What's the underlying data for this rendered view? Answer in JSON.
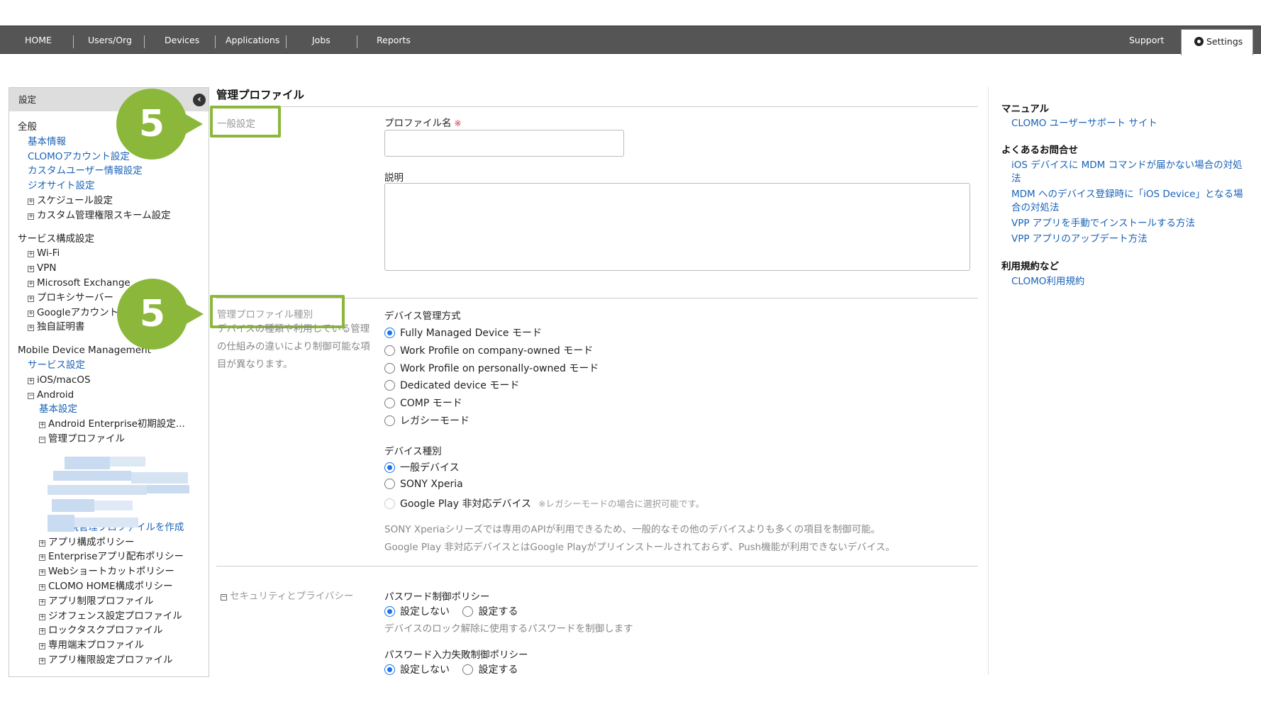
{
  "nav": {
    "items": [
      "HOME",
      "Users/Org",
      "Devices",
      "Applications",
      "Jobs",
      "Reports"
    ],
    "support": "Support",
    "settings": "Settings"
  },
  "sidebar": {
    "header": "設定",
    "tree": [
      {
        "text": "全般",
        "type": "heading"
      },
      {
        "text": "基本情報",
        "type": "link",
        "indent": 1
      },
      {
        "text": "CLOMOアカウント設定",
        "type": "link",
        "indent": 1
      },
      {
        "text": "カスタムユーザー情報設定",
        "type": "link",
        "indent": 1
      },
      {
        "text": "ジオサイト設定",
        "type": "link",
        "indent": 1
      },
      {
        "text": "スケジュール設定",
        "type": "expand",
        "indent": 1
      },
      {
        "text": "カスタム管理権限スキーム設定",
        "type": "expand",
        "indent": 1
      },
      {
        "text": "",
        "type": "gap"
      },
      {
        "text": "サービス構成設定",
        "type": "heading"
      },
      {
        "text": "Wi-Fi",
        "type": "expand",
        "indent": 1
      },
      {
        "text": "VPN",
        "type": "expand",
        "indent": 1
      },
      {
        "text": "Microsoft Exchange",
        "type": "expand",
        "indent": 1
      },
      {
        "text": "プロキシサーバー",
        "type": "expand",
        "indent": 1
      },
      {
        "text": "Googleアカウント",
        "type": "expand",
        "indent": 1
      },
      {
        "text": "独自証明書",
        "type": "expand",
        "indent": 1
      },
      {
        "text": "",
        "type": "gap"
      },
      {
        "text": "Mobile Device Management",
        "type": "heading"
      },
      {
        "text": "サービス設定",
        "type": "link",
        "indent": 1
      },
      {
        "text": "iOS/macOS",
        "type": "expand",
        "indent": 1
      },
      {
        "text": "Android",
        "type": "collapse",
        "indent": 1
      },
      {
        "text": "基本設定",
        "type": "link",
        "indent": 2
      },
      {
        "text": "Android Enterprise初期設定...",
        "type": "expand",
        "indent": 2
      },
      {
        "text": "管理プロファイル",
        "type": "collapse",
        "indent": 2
      },
      {
        "text": "",
        "type": "blur"
      },
      {
        "text": "",
        "type": "blur"
      },
      {
        "text": "",
        "type": "blur"
      },
      {
        "text": "",
        "type": "blur"
      },
      {
        "text": "",
        "type": "blur"
      },
      {
        "text": "...新規管理プロファイルを作成",
        "type": "link",
        "indent": 3
      },
      {
        "text": "アプリ構成ポリシー",
        "type": "expand",
        "indent": 2
      },
      {
        "text": "Enterpriseアプリ配布ポリシー",
        "type": "expand",
        "indent": 2
      },
      {
        "text": "Webショートカットポリシー",
        "type": "expand",
        "indent": 2
      },
      {
        "text": "CLOMO HOME構成ポリシー",
        "type": "expand",
        "indent": 2
      },
      {
        "text": "アプリ制限プロファイル",
        "type": "expand",
        "indent": 2
      },
      {
        "text": "ジオフェンス設定プロファイル",
        "type": "expand",
        "indent": 2
      },
      {
        "text": "ロックタスクプロファイル",
        "type": "expand",
        "indent": 2
      },
      {
        "text": "専用端末プロファイル",
        "type": "expand",
        "indent": 2
      },
      {
        "text": "アプリ権限設定プロファイル",
        "type": "expand",
        "indent": 2
      }
    ]
  },
  "main": {
    "title": "管理プロファイル",
    "general": {
      "label": "一般設定",
      "profile_name_label": "プロファイル名",
      "required_mark": "※",
      "profile_name_value": "",
      "description_label": "説明",
      "description_value": ""
    },
    "profile_type": {
      "label": "管理プロファイル種別",
      "help": "デバイスの種類や利用している管理の仕組みの違いにより制御可能な項目が異なります。",
      "mgmt_method_label": "デバイス管理方式",
      "mgmt_options": [
        {
          "label": "Fully Managed Device モード",
          "checked": true
        },
        {
          "label": "Work Profile on company-owned モード",
          "checked": false
        },
        {
          "label": "Work Profile on personally-owned モード",
          "checked": false
        },
        {
          "label": "Dedicated device モード",
          "checked": false
        },
        {
          "label": "COMP モード",
          "checked": false
        },
        {
          "label": "レガシーモード",
          "checked": false
        }
      ],
      "device_type_label": "デバイス種別",
      "device_options": [
        {
          "label": "一般デバイス",
          "checked": true
        },
        {
          "label": "SONY Xperia",
          "checked": false
        },
        {
          "label": "Google Play 非対応デバイス",
          "checked": false,
          "disabled": true,
          "note": "※レガシーモードの場合に選択可能です。"
        }
      ],
      "note1": "SONY Xperiaシリーズでは専用のAPIが利用できるため、一般的なその他のデバイスよりも多くの項目を制御可能。",
      "note2": "Google Play 非対応デバイスとはGoogle Playがプリインストールされておらず、Push機能が利用できないデバイス。"
    },
    "security": {
      "label": "セキュリティとプライバシー",
      "pw_policy_label": "パスワード制御ポリシー",
      "pw_policy_off": "設定しない",
      "pw_policy_on": "設定する",
      "pw_policy_help": "デバイスのロック解除に使用するパスワードを制御します",
      "pw_fail_label": "パスワード入力失敗制御ポリシー",
      "pw_fail_off": "設定しない",
      "pw_fail_on": "設定する"
    },
    "badges": [
      "5",
      "5"
    ]
  },
  "right_panel": {
    "manual_head": "マニュアル",
    "manual_links": [
      "CLOMO ユーザーサポート サイト"
    ],
    "faq_head": "よくあるお問合せ",
    "faq_links": [
      "iOS デバイスに MDM コマンドが届かない場合の対処法",
      "MDM へのデバイス登録時に「iOS Device」となる場合の対処法",
      "VPP アプリを手動でインストールする方法",
      "VPP アプリのアップデート方法"
    ],
    "terms_head": "利用規約など",
    "terms_links": [
      "CLOMO利用規約"
    ]
  },
  "colors": {
    "nav_bg": "#555555",
    "link": "#1a63b8",
    "highlight": "#8bb83a",
    "radio_on": "#1a73e8"
  }
}
